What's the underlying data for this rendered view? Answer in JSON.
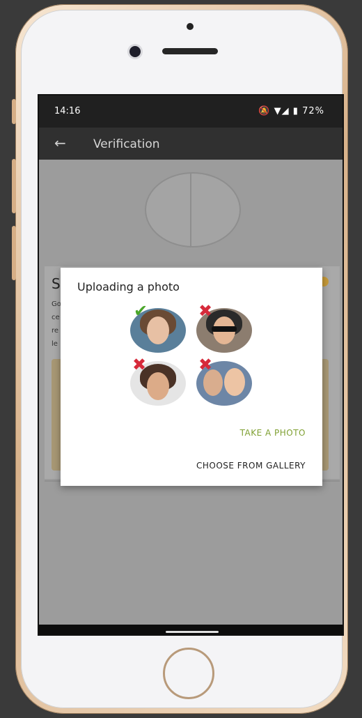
{
  "status_bar": {
    "time": "14:16",
    "icons": "🔕 ▼◢ ▮ 72%"
  },
  "app_bar": {
    "back_icon": "←",
    "title": "Verification"
  },
  "background": {
    "heading_initial": "S",
    "line_fragments": [
      "Go",
      "ce",
      "re",
      "le"
    ]
  },
  "dialog": {
    "title": "Uploading a photo",
    "take_photo": "TAKE A PHOTO",
    "choose_gallery": "CHOOSE FROM GALLERY",
    "samples": [
      {
        "name": "valid-example",
        "mark": "✔"
      },
      {
        "name": "sunglasses-example",
        "mark": "✖"
      },
      {
        "name": "cropped-example",
        "mark": "✖"
      },
      {
        "name": "group-example",
        "mark": "✖"
      }
    ]
  },
  "colors": {
    "accent_green": "#7fa032",
    "check_green": "#4aa62a",
    "cross_red": "#d62a3a",
    "appbar": "#303030",
    "statusbar": "#202020"
  }
}
